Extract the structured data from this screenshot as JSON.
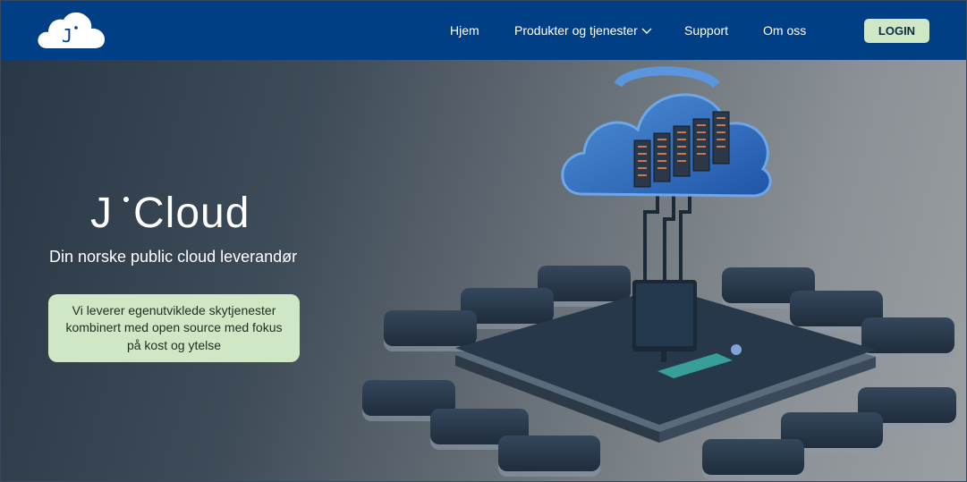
{
  "brand": {
    "logo_letter": "J",
    "name_j": "J",
    "name_rest": "Cloud"
  },
  "nav": {
    "items": [
      {
        "label": "Hjem"
      },
      {
        "label": "Produkter og tjenester"
      },
      {
        "label": "Support"
      },
      {
        "label": "Om oss"
      }
    ],
    "login_label": "LOGIN"
  },
  "hero": {
    "tagline": "Din norske public cloud leverandør",
    "info": "Vi leverer egenutviklede skytjenester kombinert med open source med fokus på kost og ytelse"
  },
  "colors": {
    "nav_bg": "#003f86",
    "accent_green": "#cfe7c5",
    "hero_dark": "#2a3746"
  },
  "icons": {
    "dropdown": "chevron-down-icon",
    "logo": "cloud-logo-icon"
  }
}
